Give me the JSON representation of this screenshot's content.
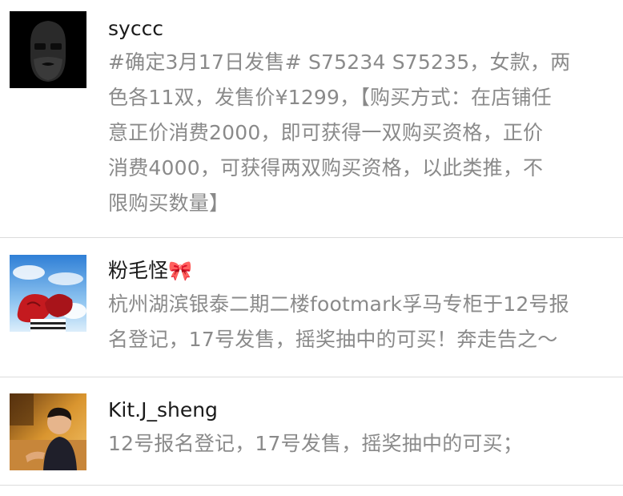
{
  "comments": [
    {
      "username": "syccc",
      "avatar": "bearded-man-avatar",
      "lines": [
        "#确定3月17日发售# S75234 S75235，女款，两",
        "色各11双，发售价¥1299，【购买方式：在店铺任",
        "意正价消费2000，即可获得一双购买资格，正价",
        "消费4000，可获得两双购买资格，以此类推，不",
        "限购买数量】"
      ]
    },
    {
      "username": "粉毛怪",
      "username_emoji": "🎀",
      "avatar": "red-bow-sky-avatar",
      "lines": [
        "杭州湖滨银泰二期二楼footmark孚马专柜于12号报",
        "名登记，17号发售，摇奖抽中的可买！奔走告之～"
      ]
    },
    {
      "username": "Kit.J_sheng",
      "avatar": "child-photo-avatar",
      "lines": [
        "12号报名登记，17号发售，摇奖抽中的可买；"
      ]
    }
  ],
  "colors": {
    "username": "#1a1a1a",
    "text": "#8a8a8a",
    "divider": "#dcdcdc"
  }
}
